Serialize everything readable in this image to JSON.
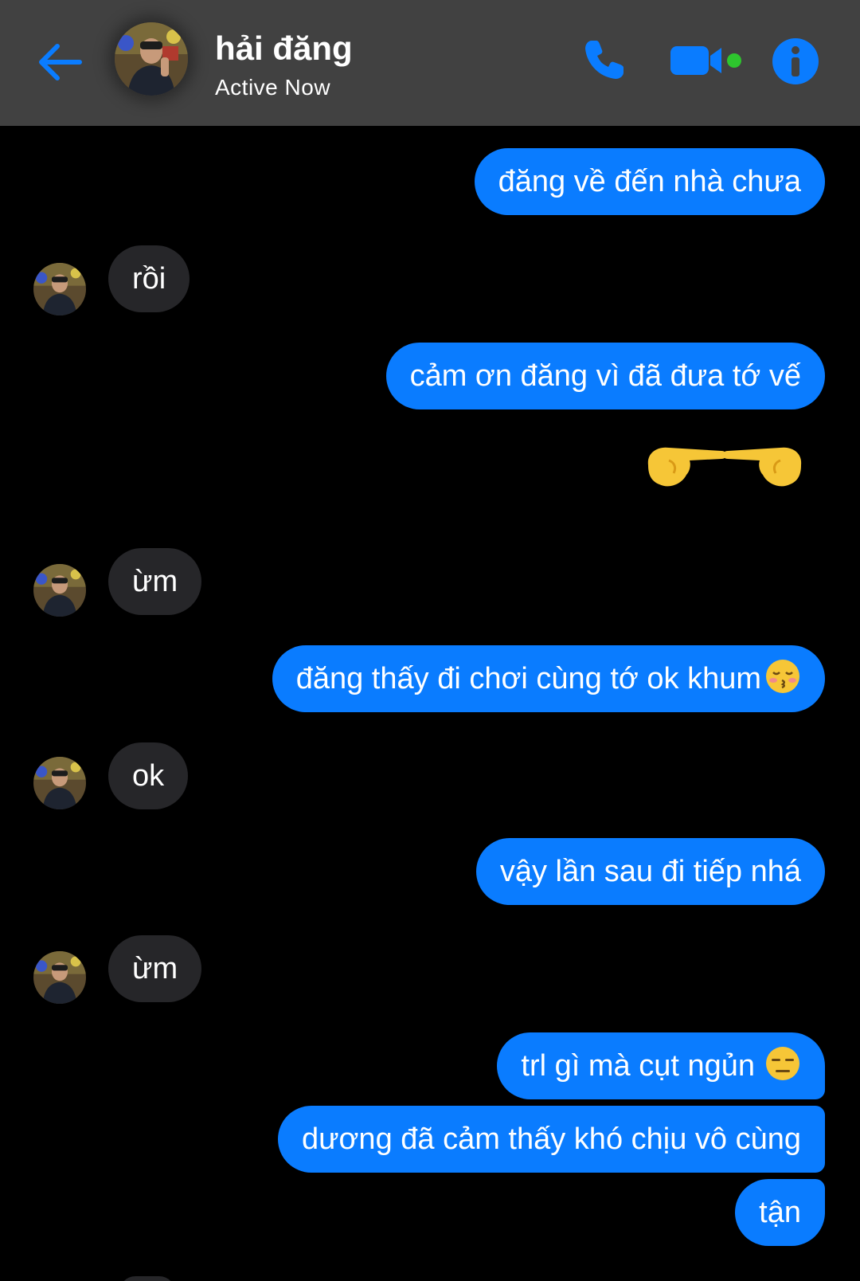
{
  "header": {
    "name": "hải đăng",
    "status": "Active Now",
    "icons": {
      "back": "arrow-left-icon",
      "phone": "phone-icon",
      "video": "video-camera-icon",
      "info": "info-icon"
    },
    "accent_color": "#0a7cff",
    "active_dot_color": "#2ec52e"
  },
  "messages": [
    {
      "from": "me",
      "text": "đăng về đến nhà chưa"
    },
    {
      "from": "them",
      "text": "rồi"
    },
    {
      "from": "me",
      "text": "cảm ơn đăng vì đã đưa tớ vế"
    },
    {
      "from": "me",
      "emoji": "pointing-fingers-together-emoji"
    },
    {
      "from": "them",
      "text": "ừm"
    },
    {
      "from": "me",
      "text": "đăng thấy đi chơi cùng tớ ok khum",
      "emoji": "kissing-face-closed-eyes-emoji"
    },
    {
      "from": "them",
      "text": "ok"
    },
    {
      "from": "me",
      "text": "vậy lần sau đi tiếp nhá"
    },
    {
      "from": "them",
      "text": "ừm"
    },
    {
      "from": "me",
      "text": "trl gì mà cụt ngủn",
      "emoji": "expressionless-face-emoji"
    },
    {
      "from": "me",
      "text": "dương đã cảm thấy khó chịu vô cùng"
    },
    {
      "from": "me",
      "text": "tận"
    }
  ]
}
